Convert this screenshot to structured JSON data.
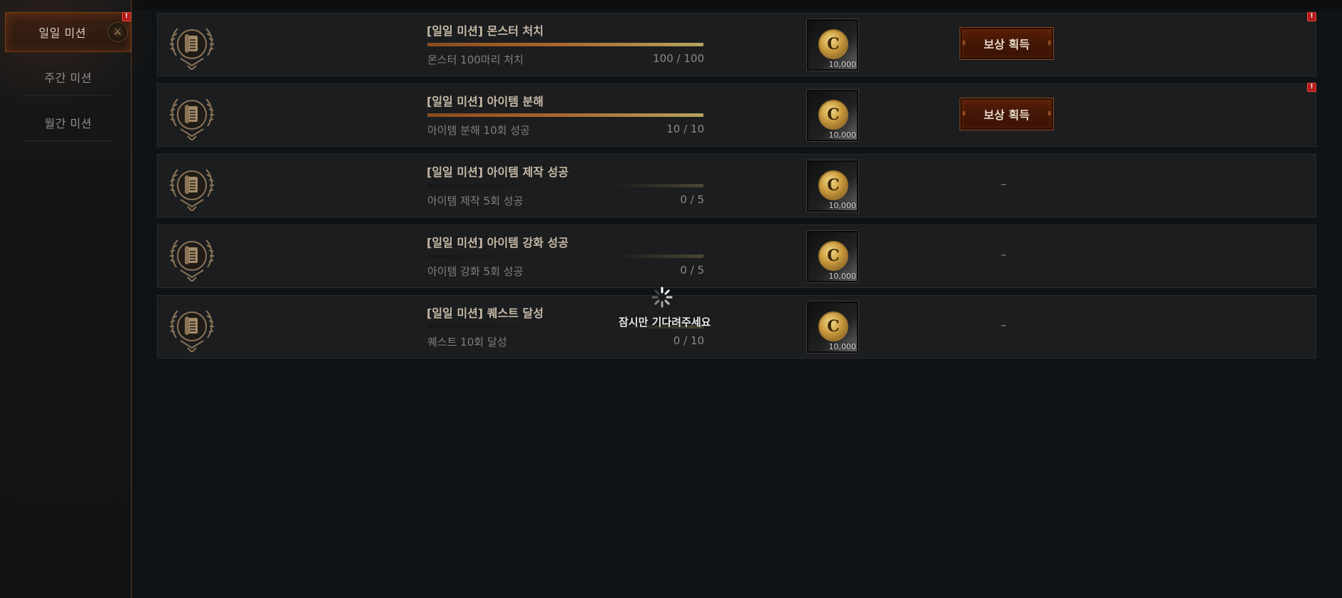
{
  "sidebar": {
    "items": [
      {
        "label": "일일 미션",
        "active": true,
        "alert": "!"
      },
      {
        "label": "주간 미션",
        "active": false
      },
      {
        "label": "월간 미션",
        "active": false
      }
    ]
  },
  "missions": [
    {
      "title": "[일일 미션] 몬스터 처치",
      "desc": "몬스터 100마리 처치",
      "count": "100 / 100",
      "progress": 1.0,
      "reward_amount": "10,000",
      "action": "보상 획득",
      "alert": "!"
    },
    {
      "title": "[일일 미션] 아이템 분해",
      "desc": "아이템 분해 10회 성공",
      "count": "10 / 10",
      "progress": 1.0,
      "reward_amount": "10,000",
      "action": "보상 획득",
      "alert": "!"
    },
    {
      "title": "[일일 미션] 아이템 제작 성공",
      "desc": "아이템 제작 5회 성공",
      "count": "0 / 5",
      "progress": 0.0,
      "reward_amount": "10,000",
      "action": "–"
    },
    {
      "title": "[일일 미션] 아이템 강화 성공",
      "desc": "아이템 강화 5회 성공",
      "count": "0 / 5",
      "progress": 0.0,
      "reward_amount": "10,000",
      "action": "–"
    },
    {
      "title": "[일일 미션] 퀘스트 달성",
      "desc": "퀘스트 10회 달성",
      "count": "0 / 10",
      "progress": 0.0,
      "reward_amount": "10,000",
      "action": "–"
    }
  ],
  "coin_letter": "C",
  "loading": {
    "text": "잠시만 기다려주세요"
  },
  "colors": {
    "accent": "#8a4a1e",
    "alert": "#b41a1a",
    "progress": "#a96a2d"
  },
  "icons": {
    "mission": "scroll-laurel-icon",
    "reward": "gold-coin-icon",
    "spinner": "loading-spinner-icon"
  }
}
